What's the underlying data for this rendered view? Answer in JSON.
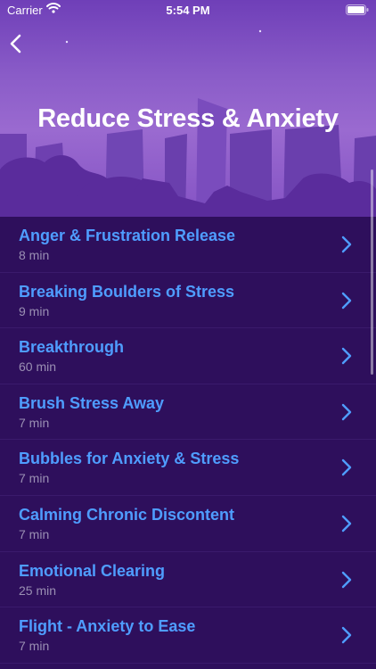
{
  "status_bar": {
    "carrier": "Carrier",
    "time": "5:54 PM"
  },
  "header": {
    "title": "Reduce Stress & Anxiety",
    "back_icon": "chevron-left-icon"
  },
  "list": {
    "items": [
      {
        "title": "Anger & Frustration Release",
        "duration": "8 min"
      },
      {
        "title": "Breaking Boulders of Stress",
        "duration": "9 min"
      },
      {
        "title": "Breakthrough",
        "duration": "60 min"
      },
      {
        "title": "Brush Stress Away",
        "duration": "7 min"
      },
      {
        "title": "Bubbles for Anxiety & Stress",
        "duration": "7 min"
      },
      {
        "title": "Calming Chronic Discontent",
        "duration": "7 min"
      },
      {
        "title": "Emotional Clearing",
        "duration": "25 min"
      },
      {
        "title": "Flight - Anxiety to Ease",
        "duration": "7 min"
      }
    ]
  },
  "colors": {
    "header_top": "#6f3fb8",
    "silhouette": "#5a2c9c",
    "list_background": "#2e0f5c",
    "item_title": "#4f9dff",
    "item_subtitle": "#9a8fb3"
  }
}
